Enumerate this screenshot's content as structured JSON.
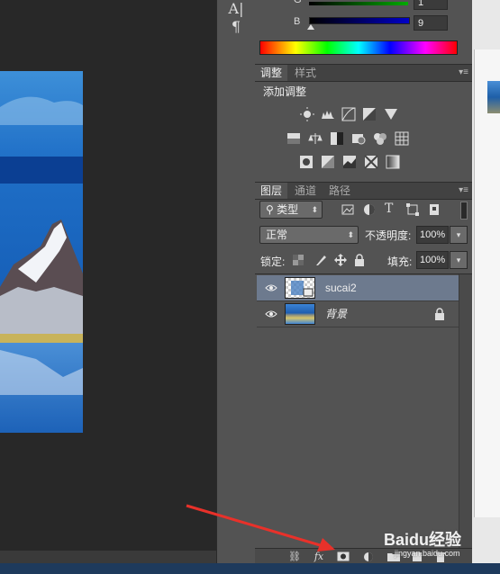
{
  "tools": {
    "char_label": "A|",
    "para_label": "¶"
  },
  "color_panel": {
    "g_label": "G",
    "g_value": "1",
    "b_label": "B",
    "b_value": "9"
  },
  "adjustments_panel": {
    "tab_adjust": "调整",
    "tab_styles": "样式",
    "title": "添加调整",
    "icons": [
      "brightness-contrast-icon",
      "levels-icon",
      "curves-icon",
      "exposure-icon",
      "vibrance-icon",
      "hue-saturation-icon",
      "color-balance-icon",
      "black-white-icon",
      "photo-filter-icon",
      "channel-mixer-icon",
      "color-lookup-icon",
      "invert-icon",
      "posterize-icon",
      "threshold-icon",
      "selective-color-icon",
      "gradient-map-icon"
    ]
  },
  "layers_panel": {
    "tab_layers": "图层",
    "tab_channels": "通道",
    "tab_paths": "路径",
    "filter_label": "类型",
    "blend_mode": "正常",
    "opacity_label": "不透明度:",
    "opacity_value": "100%",
    "lock_label": "锁定:",
    "fill_label": "填充:",
    "fill_value": "100%",
    "layers": [
      {
        "name": "sucai2",
        "selected": true
      },
      {
        "name": "背景",
        "selected": false,
        "locked": true
      }
    ],
    "footer": {
      "fx_label": "fx"
    }
  },
  "watermark": {
    "text": "Baidu经验",
    "url": "jingyan.baidu.com"
  },
  "colors": {
    "panel_bg": "#535353",
    "selected_layer": "#6d7a8e",
    "arrow": "#e8312a"
  }
}
